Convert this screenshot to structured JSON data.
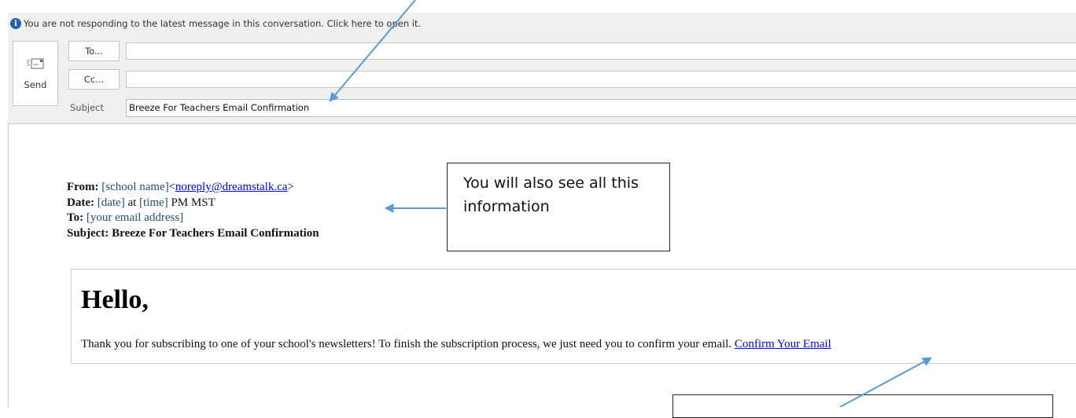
{
  "infobar": {
    "icon": "info-icon",
    "icon_glyph": "i",
    "message": "You are not responding to the latest message in this conversation. Click here to open it."
  },
  "compose": {
    "send_label": "Send",
    "send_icon": "send-envelope-icon",
    "to_label": "To...",
    "to_value": "",
    "cc_label": "Cc...",
    "cc_value": "",
    "subject_label": "Subject",
    "subject_value": "Breeze For Teachers Email Confirmation"
  },
  "message": {
    "from_label": "From:",
    "from_name": "[school name]",
    "lt": "<",
    "from_email": "noreply@dreamstalk.ca",
    "gt": ">",
    "date_label": "Date:",
    "date_value": "[date]",
    "at": "at",
    "time_value": "[time]",
    "tz": "PM MST",
    "to_label": "To:",
    "to_value": "[your email address]",
    "subject_line": "Subject: Breeze For Teachers Email Confirmation",
    "greeting": "Hello,",
    "body_text": "Thank you for subscribing to one of your school's newsletters! To finish the subscription process, we just need you to confirm your email.",
    "confirm_link": "Confirm Your Email"
  },
  "annotations": {
    "callout_text": "You will also see all this information",
    "arrow_color": "#5b9bd5"
  }
}
